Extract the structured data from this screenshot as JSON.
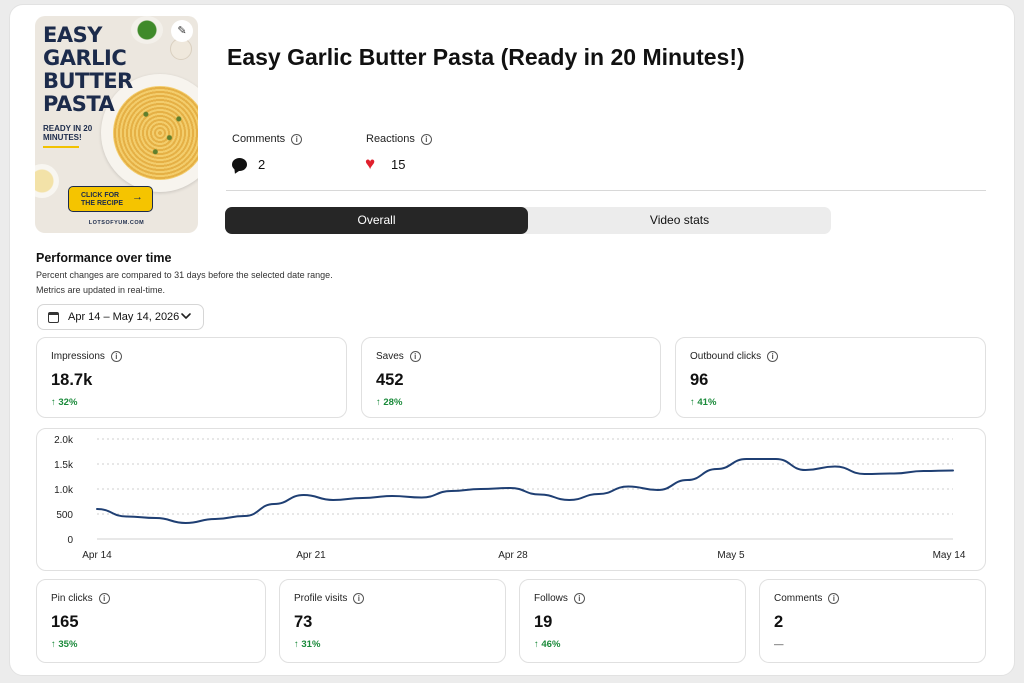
{
  "pin": {
    "image": {
      "headline": "EASY GARLIC BUTTER PASTA",
      "subline": "READY IN 20 MINUTES!",
      "cta": "CLICK FOR THE RECIPE",
      "site": "LOTSOFYUM.COM"
    },
    "title": "Easy Garlic Butter Pasta (Ready in 20 Minutes!)",
    "comments": {
      "label": "Comments",
      "value": "2"
    },
    "reactions": {
      "label": "Reactions",
      "value": "15"
    }
  },
  "tabs": [
    {
      "label": "Overall",
      "active": true
    },
    {
      "label": "Video stats",
      "active": false
    }
  ],
  "performance": {
    "title": "Performance over time",
    "note1": "Percent changes are compared to 31 days before the selected date range.",
    "note2": "Metrics are updated in real-time.",
    "date_range": "Apr 14 – May 14, 2026"
  },
  "top_metrics": [
    {
      "label": "Impressions",
      "value": "18.7k",
      "delta": "32%"
    },
    {
      "label": "Saves",
      "value": "452",
      "delta": "28%"
    },
    {
      "label": "Outbound clicks",
      "value": "96",
      "delta": "41%"
    }
  ],
  "bottom_metrics": [
    {
      "label": "Pin clicks",
      "value": "165",
      "delta": "35%"
    },
    {
      "label": "Profile visits",
      "value": "73",
      "delta": "31%"
    },
    {
      "label": "Follows",
      "value": "19",
      "delta": "46%"
    },
    {
      "label": "Comments",
      "value": "2",
      "delta": "—"
    }
  ],
  "chart_data": {
    "type": "line",
    "x_ticks": [
      "Apr 14",
      "Apr 21",
      "Apr 28",
      "May 5",
      "May 14"
    ],
    "y_ticks": [
      "0",
      "500",
      "1.0k",
      "1.5k",
      "2.0k"
    ],
    "ylim": [
      0,
      2000
    ],
    "grid": true,
    "color": "#1f3f73",
    "series": [
      {
        "values": [
          600,
          450,
          420,
          320,
          400,
          460,
          700,
          880,
          780,
          820,
          860,
          830,
          960,
          1000,
          1020,
          890,
          780,
          900,
          1050,
          980,
          1180,
          1400,
          1600,
          1600,
          1380,
          1450,
          1300,
          1310,
          1360,
          1370
        ]
      }
    ]
  }
}
